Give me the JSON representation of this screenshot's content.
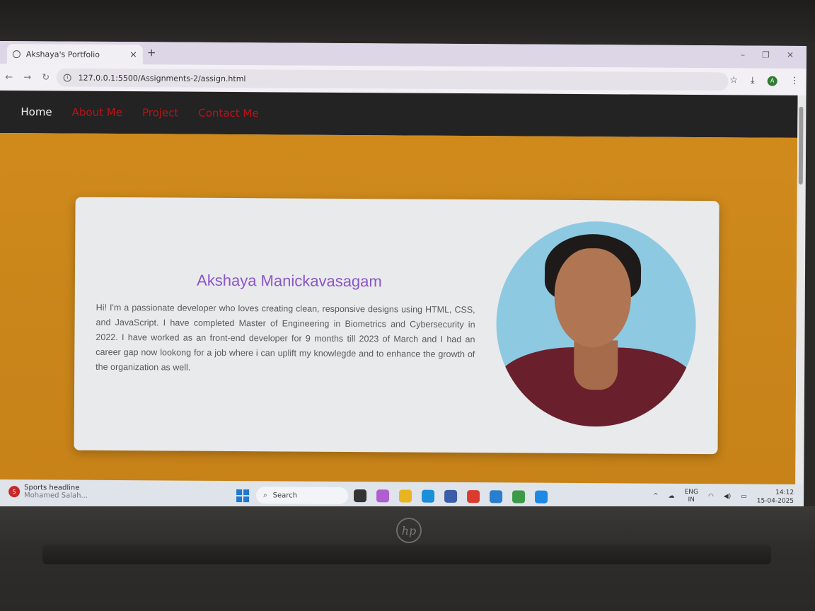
{
  "browser": {
    "tab_title": "Akshaya's Portfolio",
    "tab_close": "×",
    "new_tab": "+",
    "window_controls": [
      "–",
      "❐",
      "✕"
    ],
    "url": "127.0.0.1:5500/Assignments-2/assign.html",
    "profile_initial": "A"
  },
  "site_nav": {
    "home": "Home",
    "links": [
      "About Me",
      "Project",
      "Contact Me"
    ]
  },
  "profile": {
    "name": "Akshaya Manickavasagam",
    "bio": "Hi! I'm a passionate developer who loves creating clean, responsive designs using HTML, CSS, and JavaScript. I have completed Master of Engineering in Biometrics and Cybersecurity in 2022. I have worked as an front-end developer for 9 months till 2023 of March and I had an career gap now lookong for a job where i can uplift my knowlegde and to enhance the growth of the organization as well."
  },
  "taskbar": {
    "news_badge": "5",
    "news_title": "Sports headline",
    "news_sub": "Mohamed Salah...",
    "search_label": "Search",
    "lang_top": "ENG",
    "lang_bottom": "IN",
    "time": "14:12",
    "date": "15-04-2025"
  },
  "device": {
    "brand": "hp"
  },
  "colors": {
    "nav_link": "#b8131a",
    "name": "#8a57c8",
    "content_bg": "#d08a1c"
  }
}
